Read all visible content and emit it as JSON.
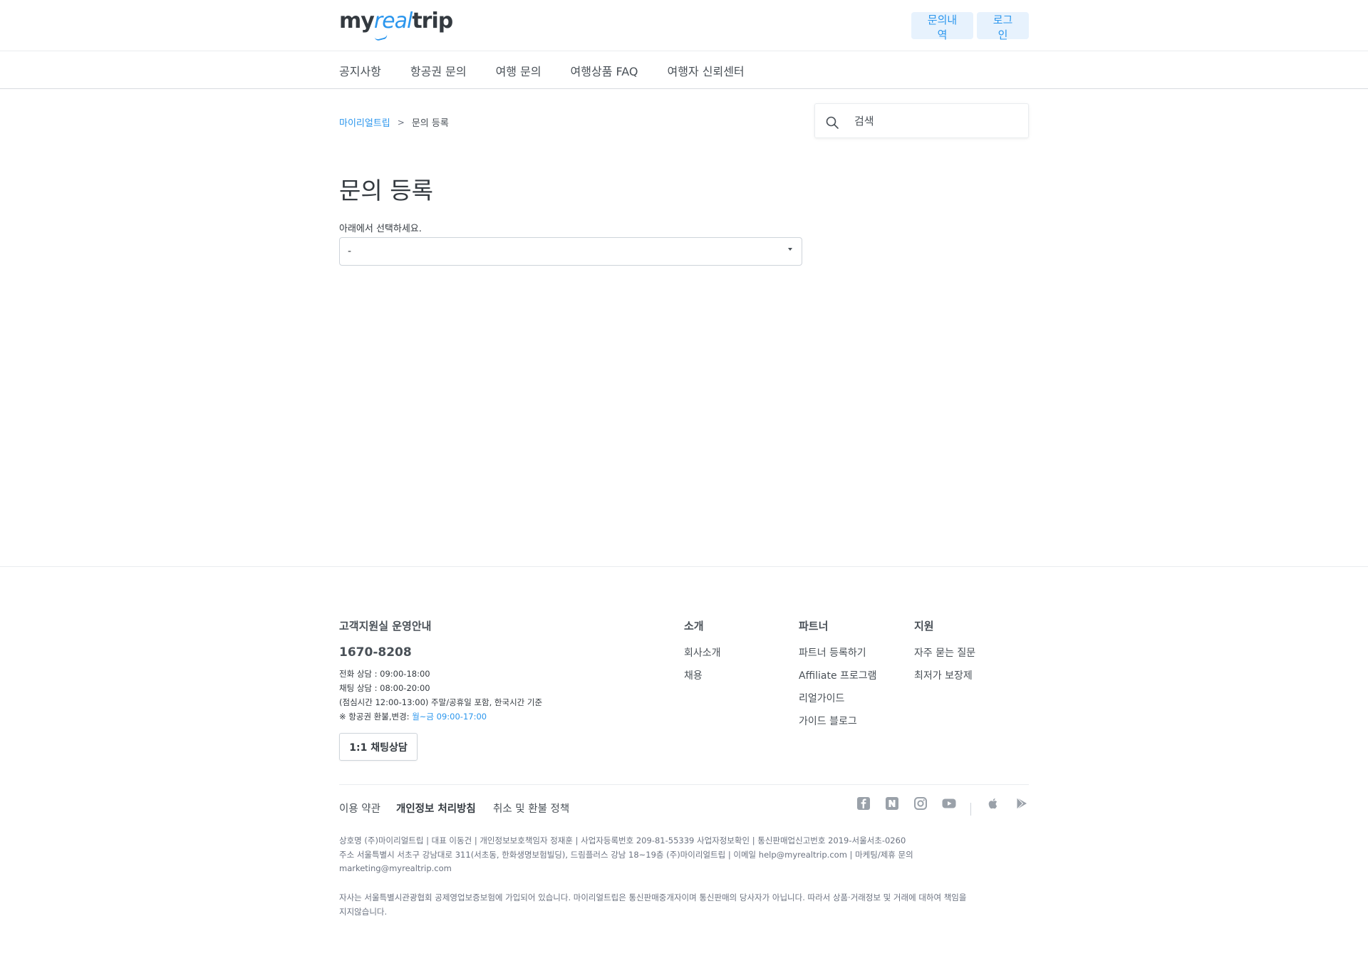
{
  "header": {
    "logo": {
      "part1": "my",
      "part2": "real",
      "part3": "trip"
    },
    "inquiries_label": "문의내역",
    "login_label": "로그인"
  },
  "nav": {
    "items": [
      {
        "label": "공지사항"
      },
      {
        "label": "항공권 문의"
      },
      {
        "label": "여행 문의"
      },
      {
        "label": "여행상품 FAQ"
      },
      {
        "label": "여행자 신뢰센터"
      }
    ]
  },
  "breadcrumb": {
    "home": "마이리얼트립",
    "separator": ">",
    "current": "문의 등록"
  },
  "search": {
    "placeholder": "검색"
  },
  "main": {
    "title": "문의 등록",
    "select_label": "아래에서 선택하세요.",
    "select_value": "-"
  },
  "footer": {
    "cs": {
      "title": "고객지원실 운영안내",
      "phone": "1670-8208",
      "hours": [
        "전화 상담 : 09:00-18:00",
        "채팅 상담 : 08:00-20:00",
        "(점심시간 12:00-13:00) 주말/공휴일 포함, 한국시간 기준"
      ],
      "air_note_prefix": "※ 항공권 환불,변경: ",
      "air_note_hours": "월~금 09:00-17:00",
      "chat_button": "1:1 채팅상담"
    },
    "about": {
      "title": "소개",
      "links": [
        "회사소개",
        "채용"
      ]
    },
    "partner": {
      "title": "파트너",
      "links": [
        "파트너 등록하기",
        "Affiliate 프로그램",
        "리얼가이드",
        "가이드 블로그"
      ]
    },
    "support": {
      "title": "지원",
      "links": [
        "자주 묻는 질문",
        "최저가 보장제"
      ]
    },
    "policies": [
      "이용 약관",
      "개인정보 처리방침",
      "취소 및 환불 정책"
    ],
    "sns_icons": [
      "facebook-icon",
      "naver-icon",
      "instagram-icon",
      "youtube-icon",
      "apple-icon",
      "google-play-icon"
    ],
    "company_info": [
      "상호명 (주)마이리얼트립 | 대표 이동건 | 개인정보보호책임자 정재훈 | 사업자등록번호 209-81-55339 사업자정보확인 | 통신판매업신고번호 2019-서울서초-0260",
      "주소 서울특별시 서초구 강남대로 311(서초동, 한화생명보험빌딩), 드림플러스 강남 18~19층 (주)마이리얼트립 | 이메일 help@myrealtrip.com | 마케팅/제휴 문의",
      "marketing@myrealtrip.com"
    ],
    "disclaimer": [
      "자사는 서울특별시관광협회 공제영업보증보험에 가입되어 있습니다. 마이리얼트립은 통신판매중개자이며 통신판매의 당사자가 아닙니다. 따라서 상품·거래정보 및 거래에 대하여 책임을",
      "지지않습니다."
    ]
  },
  "colors": {
    "accent": "#2b96ed",
    "accent_bg": "#e7f2fd",
    "text": "#343a40"
  }
}
